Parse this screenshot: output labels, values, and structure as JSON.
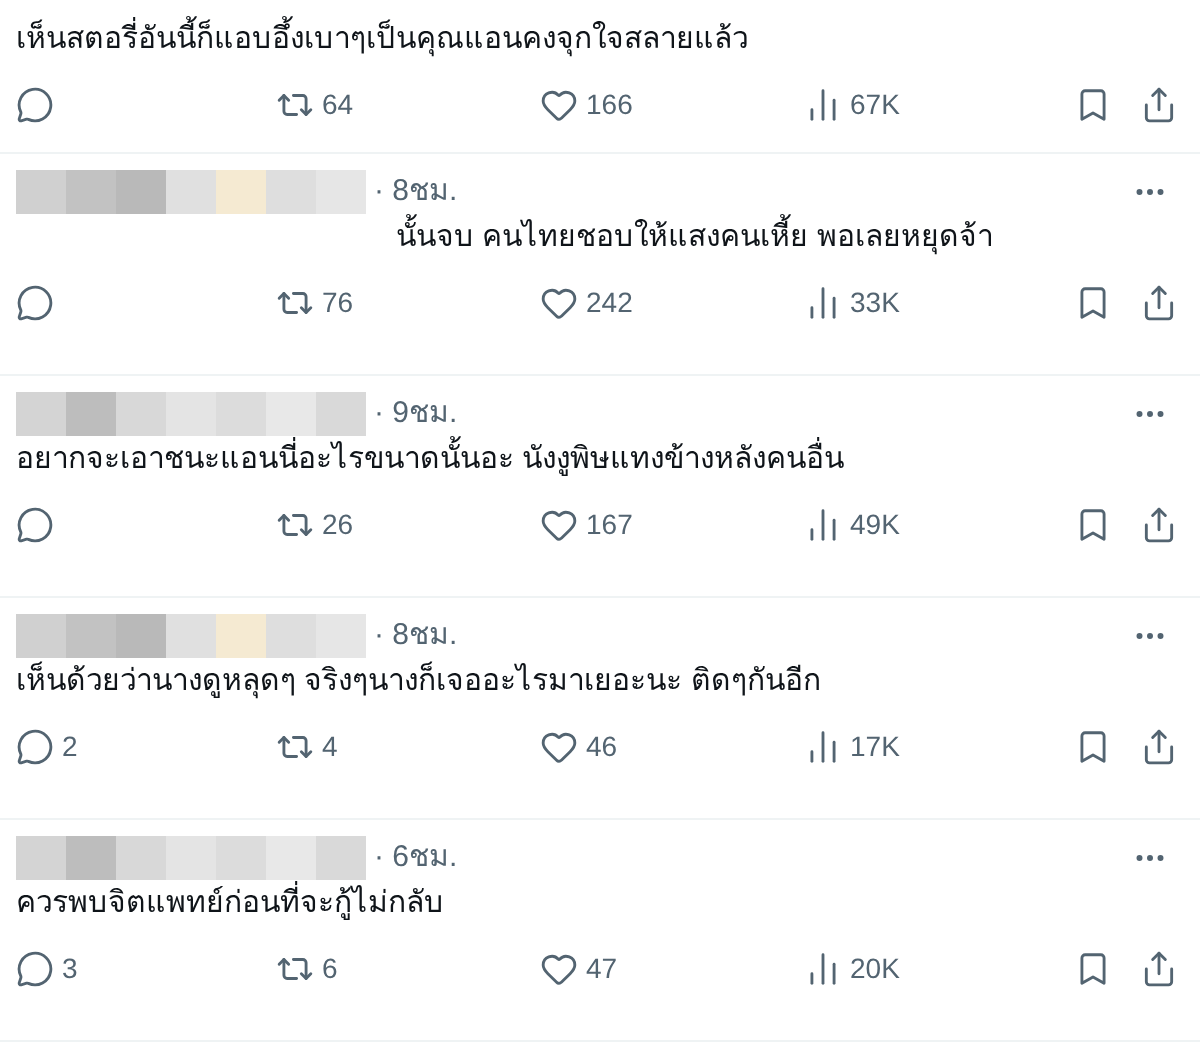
{
  "posts": [
    {
      "kind": "plain",
      "text": "เห็นสตอรี่อันนี้ก็แอบอึ้งเบาๆเป็นคุณแอนคงจุกใจสลายแล้ว",
      "retweets": "64",
      "likes": "166",
      "views": "67K"
    },
    {
      "kind": "covered",
      "time": "· 8ชม.",
      "text": "นั้นจบ คนไทยชอบให้แสงคนเหี้ย พอเลยหยุดจ้า",
      "retweets": "76",
      "likes": "242",
      "views": "33K"
    },
    {
      "kind": "plain",
      "time": "· 9ชม.",
      "text": "อยากจะเอาชนะแอนนี่อะไรขนาดนั้นอะ นังงูพิษแทงข้างหลังคนอื่น",
      "retweets": "26",
      "likes": "167",
      "views": "49K"
    },
    {
      "kind": "plain",
      "time": "· 8ชม.",
      "text": "เห็นด้วยว่านางดูหลุดๆ จริงๆนางก็เจออะไรมาเยอะนะ ติดๆกันอีก",
      "replies": "2",
      "retweets": "4",
      "likes": "46",
      "views": "17K"
    },
    {
      "kind": "plain",
      "time": "· 6ชม.",
      "text": "ควรพบจิตแพทย์ก่อนที่จะกู้ไม่กลับ",
      "replies": "3",
      "retweets": "6",
      "likes": "47",
      "views": "20K"
    }
  ]
}
